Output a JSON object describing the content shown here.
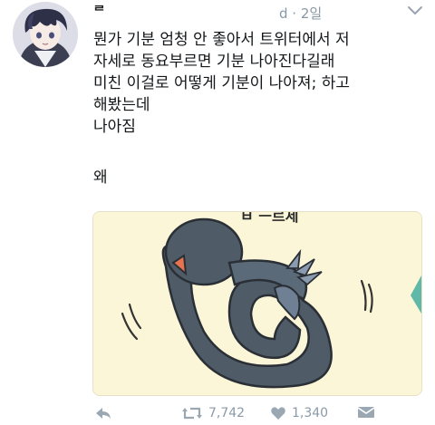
{
  "author": {
    "name": "ᄅ"
  },
  "meta": {
    "time": "d · 2일"
  },
  "tweet": {
    "lines": [
      "뭔가 기분 엄청 안 좋아서 트위터에서 저",
      "자세로 동요부르면 기분 나아진다길래",
      "미친 이걸로 어떻게 기분이 나아져; 하고",
      "해봤는데",
      "나아짐"
    ],
    "tail": "왜"
  },
  "media": {
    "caption_fragment": "ㅂ ㅡ르세"
  },
  "actions": {
    "retweets": "7,742",
    "likes": "1,340"
  },
  "icons": [
    "reply-icon",
    "retweet-icon",
    "like-icon",
    "message-icon",
    "chevron-down-icon"
  ],
  "colors": {
    "accent": "#8899a6",
    "text": "#14171a",
    "media_bg": "#fbf6d8",
    "bird": "#4f5c68"
  }
}
